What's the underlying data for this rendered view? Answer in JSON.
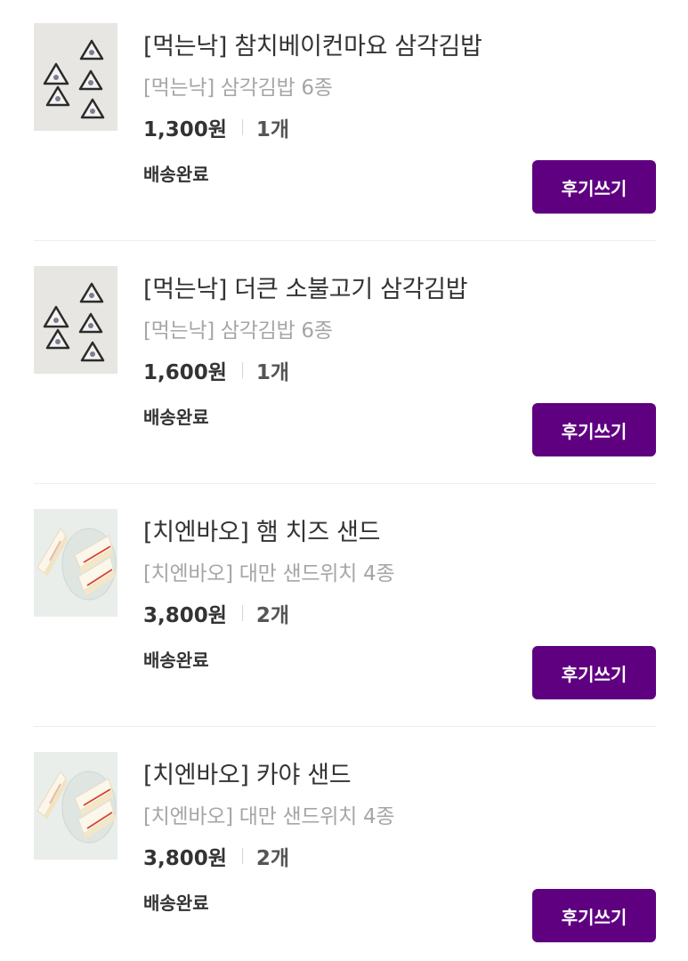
{
  "orders": [
    {
      "name": "[먹는낙] 참치베이컨마요 삼각김밥",
      "subname": "[먹는낙] 삼각김밥 6종",
      "price": "1,300원",
      "quantity": "1개",
      "status": "배송완료",
      "review_label": "후기쓰기",
      "thumbnail_icon": "triangle-kimbap-photo"
    },
    {
      "name": "[먹는낙] 더큰 소불고기 삼각김밥",
      "subname": "[먹는낙] 삼각김밥 6종",
      "price": "1,600원",
      "quantity": "1개",
      "status": "배송완료",
      "review_label": "후기쓰기",
      "thumbnail_icon": "triangle-kimbap-photo"
    },
    {
      "name": "[치엔바오] 햄 치즈 샌드",
      "subname": "[치엔바오] 대만 샌드위치 4종",
      "price": "3,800원",
      "quantity": "2개",
      "status": "배송완료",
      "review_label": "후기쓰기",
      "thumbnail_icon": "sandwich-photo"
    },
    {
      "name": "[치엔바오] 카야 샌드",
      "subname": "[치엔바오] 대만 샌드위치 4종",
      "price": "3,800원",
      "quantity": "2개",
      "status": "배송완료",
      "review_label": "후기쓰기",
      "thumbnail_icon": "sandwich-photo"
    }
  ],
  "colors": {
    "accent": "#5f0080",
    "text_primary": "#333333",
    "text_secondary": "#a6a6a6",
    "divider": "#ececec"
  }
}
